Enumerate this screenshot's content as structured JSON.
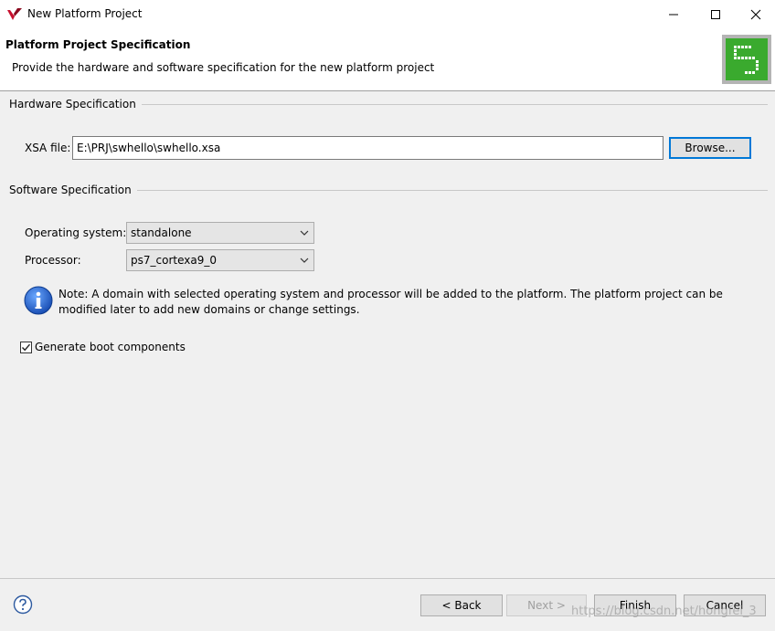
{
  "window": {
    "title": "New Platform Project",
    "controls": [
      "minimize-icon",
      "maximize-icon",
      "close-icon"
    ]
  },
  "header": {
    "title": "Platform Project Specification",
    "description": "Provide the hardware and software specification for the new platform project",
    "logo_icon": "platform-wizard-logo"
  },
  "hardware": {
    "group_label": "Hardware Specification",
    "xsa_label": "XSA file:",
    "xsa_value": "E:\\PRJ\\swhello\\swhello.xsa",
    "browse_label": "Browse..."
  },
  "software": {
    "group_label": "Software Specification",
    "os_label": "Operating system:",
    "os_value": "standalone",
    "processor_label": "Processor:",
    "processor_value": "ps7_cortexa9_0",
    "note": "Note: A domain with selected operating system and processor will be added to the platform. The platform project can be modified later to add new domains or change settings."
  },
  "boot": {
    "label": "Generate boot components",
    "checked": true
  },
  "footer": {
    "back_label": "< Back",
    "next_label": "Next >",
    "finish_label": "Finish",
    "cancel_label": "Cancel"
  },
  "watermark": "https://blog.csdn.net/hongfei_3",
  "colors": {
    "accent": "#0078d7",
    "logo_green": "#3aaa2e",
    "app_icon_red": "#c8102e"
  }
}
